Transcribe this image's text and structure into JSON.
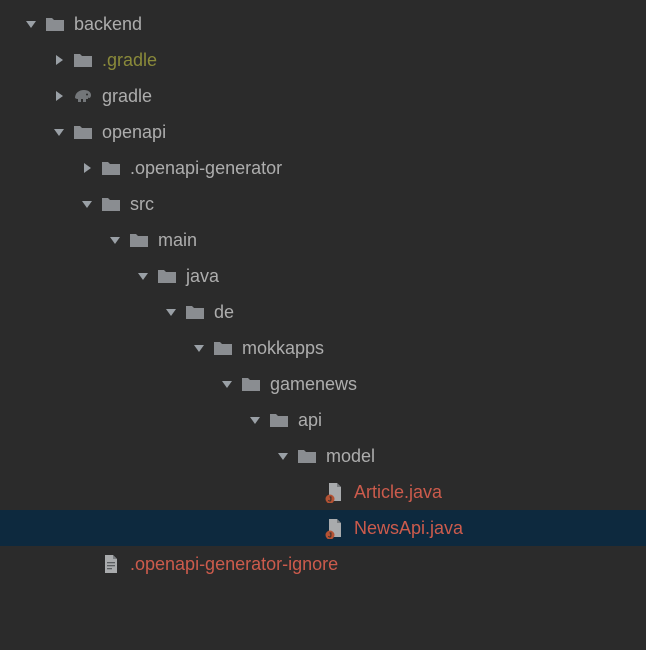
{
  "colors": {
    "normal": "#adadad",
    "olive": "#8a8a3a",
    "red": "#cc5b4c",
    "folder": "#8a8d91",
    "arrow": "#9aa0a6",
    "selection": "#0d293e",
    "elephant": "#737679"
  },
  "icons": {
    "folder": "folder-icon",
    "elephant": "gradle-elephant-icon",
    "javafile": "java-file-icon",
    "textfile": "text-file-icon"
  },
  "tree": [
    {
      "id": "backend",
      "label": "backend",
      "depth": 0,
      "arrow": "down",
      "icon": "folder",
      "color": "normal",
      "selected": false
    },
    {
      "id": "dot-gradle",
      "label": ".gradle",
      "depth": 1,
      "arrow": "right",
      "icon": "folder",
      "color": "olive",
      "selected": false
    },
    {
      "id": "gradle",
      "label": "gradle",
      "depth": 1,
      "arrow": "right",
      "icon": "elephant",
      "color": "normal",
      "selected": false
    },
    {
      "id": "openapi",
      "label": "openapi",
      "depth": 1,
      "arrow": "down",
      "icon": "folder",
      "color": "normal",
      "selected": false
    },
    {
      "id": "dot-openapi-generator",
      "label": ".openapi-generator",
      "depth": 2,
      "arrow": "right",
      "icon": "folder",
      "color": "normal",
      "selected": false
    },
    {
      "id": "src",
      "label": "src",
      "depth": 2,
      "arrow": "down",
      "icon": "folder",
      "color": "normal",
      "selected": false
    },
    {
      "id": "main",
      "label": "main",
      "depth": 3,
      "arrow": "down",
      "icon": "folder",
      "color": "normal",
      "selected": false
    },
    {
      "id": "java",
      "label": "java",
      "depth": 4,
      "arrow": "down",
      "icon": "folder",
      "color": "normal",
      "selected": false
    },
    {
      "id": "de",
      "label": "de",
      "depth": 5,
      "arrow": "down",
      "icon": "folder",
      "color": "normal",
      "selected": false
    },
    {
      "id": "mokkapps",
      "label": "mokkapps",
      "depth": 6,
      "arrow": "down",
      "icon": "folder",
      "color": "normal",
      "selected": false
    },
    {
      "id": "gamenews",
      "label": "gamenews",
      "depth": 7,
      "arrow": "down",
      "icon": "folder",
      "color": "normal",
      "selected": false
    },
    {
      "id": "api",
      "label": "api",
      "depth": 8,
      "arrow": "down",
      "icon": "folder",
      "color": "normal",
      "selected": false
    },
    {
      "id": "model",
      "label": "model",
      "depth": 9,
      "arrow": "down",
      "icon": "folder",
      "color": "normal",
      "selected": false
    },
    {
      "id": "article-java",
      "label": "Article.java",
      "depth": 10,
      "arrow": "none",
      "icon": "javafile",
      "color": "red",
      "selected": false
    },
    {
      "id": "newsapi-java",
      "label": "NewsApi.java",
      "depth": 10,
      "arrow": "none",
      "icon": "javafile",
      "color": "red",
      "selected": true
    },
    {
      "id": "openapi-generator-ignore",
      "label": ".openapi-generator-ignore",
      "depth": 2,
      "arrow": "none",
      "icon": "textfile",
      "color": "red",
      "selected": false
    }
  ]
}
